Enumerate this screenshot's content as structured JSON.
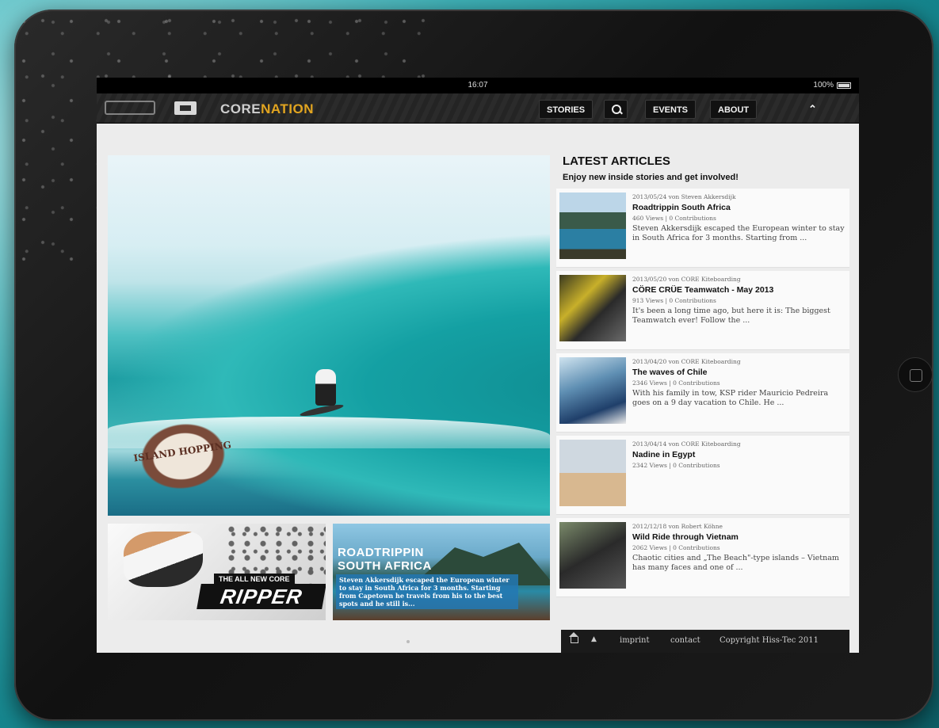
{
  "status_bar": {
    "time": "16:07",
    "battery": "100%"
  },
  "navbar": {
    "brand_part1": "CORE",
    "brand_part2": "NATION",
    "stories_label": "STORIES",
    "events_label": "EVENTS",
    "about_label": "ABOUT",
    "collapse_glyph": "⌃"
  },
  "hero": {
    "badge_text": "ISLAND HOPPING"
  },
  "promos": {
    "ripper_tag": "THE ALL NEW CORE",
    "ripper_title": "RIPPER",
    "roadtrip_title_1": "ROADTRIPPIN",
    "roadtrip_title_2": "SOUTH AFRICA",
    "roadtrip_excerpt": "Steven Akkersdijk escaped the European winter to stay in South Africa for 3 months. Starting from Capetown he travels from his to the best spots and he still is..."
  },
  "latest": {
    "title": "LATEST ARTICLES",
    "subtitle": "Enjoy new inside stories and get involved!",
    "articles": [
      {
        "meta": "2013/05/24 von Steven Akkersdijk",
        "title": "Roadtrippin South Africa",
        "stats": "460 Views | 0 Contributions",
        "excerpt": "Steven Akkersdijk escaped the European winter to stay in South Africa for 3 months. Starting from ..."
      },
      {
        "meta": "2013/05/20 von CORE Kiteboarding",
        "title": "CÖRE CRÜE Teamwatch - May 2013",
        "stats": "913 Views | 0 Contributions",
        "excerpt": "It's been a long time ago, but here it is: The biggest Teamwatch ever! Follow the ..."
      },
      {
        "meta": "2013/04/20 von CORE Kiteboarding",
        "title": "The waves of Chile",
        "stats": "2346 Views | 0 Contributions",
        "excerpt": "With his family in tow, KSP rider Mauricio Pedreira goes on a 9 day vacation to Chile. He ..."
      },
      {
        "meta": "2013/04/14 von CORE Kiteboarding",
        "title": "Nadine in Egypt",
        "stats": "2342 Views | 0 Contributions",
        "excerpt": ""
      },
      {
        "meta": "2012/12/18 von Robert Köhne",
        "title": "Wild Ride through Vietnam",
        "stats": "2062 Views | 0 Contributions",
        "excerpt": "Chaotic cities and „The Beach\"-type islands – Vietnam has many faces and one of ..."
      }
    ]
  },
  "footer": {
    "imprint": "imprint",
    "contact": "contact",
    "copyright": "Copyright Hiss-Tec 2011"
  }
}
